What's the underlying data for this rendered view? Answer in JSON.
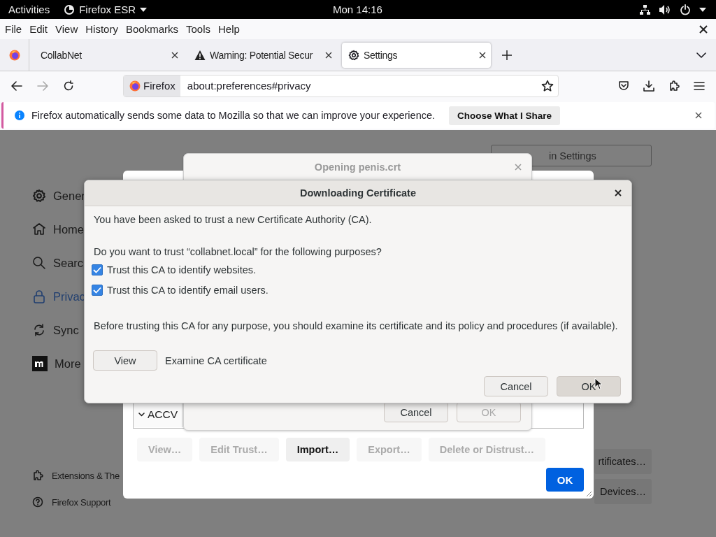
{
  "top_bar": {
    "activities": "Activities",
    "app_menu": "Firefox ESR",
    "clock": "Mon 14:16"
  },
  "menu_bar": {
    "items": [
      "File",
      "Edit",
      "View",
      "History",
      "Bookmarks",
      "Tools",
      "Help"
    ]
  },
  "tabs": [
    {
      "label": "CollabNet",
      "selected": false
    },
    {
      "label": "Warning: Potential Secur",
      "selected": false
    },
    {
      "label": "Settings",
      "selected": true
    }
  ],
  "address_bar": {
    "identity": "Firefox",
    "url": "about:preferences#privacy"
  },
  "notification": {
    "message": "Firefox automatically sends some data to Mozilla so that we can improve your experience.",
    "button": "Choose What I Share"
  },
  "settings": {
    "search": {
      "value": "in Settings"
    },
    "nav": [
      {
        "label": "Gener",
        "selected": false
      },
      {
        "label": "Home",
        "selected": false
      },
      {
        "label": "Searc",
        "selected": false
      },
      {
        "label": "Privac",
        "selected": true
      },
      {
        "label": "Sync",
        "selected": false
      },
      {
        "label": "More",
        "selected": false
      }
    ],
    "footer": [
      "Extensions & The",
      "Firefox Support"
    ],
    "buttons": [
      "rtificates…",
      "Devices…"
    ]
  },
  "certificate_manager": {
    "tree_rows": [
      {
        "label": "ACCV",
        "expanded": true
      }
    ],
    "buttons": [
      {
        "label": "View…",
        "disabled": true
      },
      {
        "label": "Edit Trust…",
        "disabled": true
      },
      {
        "label": "Import…",
        "disabled": false
      },
      {
        "label": "Export…",
        "disabled": true
      },
      {
        "label": "Delete or Distrust…",
        "disabled": true
      }
    ],
    "ok": "OK"
  },
  "opening_dialog": {
    "title": "Opening penis.crt",
    "buttons": [
      {
        "label": "Cancel",
        "disabled": false
      },
      {
        "label": "OK",
        "disabled": true
      }
    ]
  },
  "download_dialog": {
    "title": "Downloading Certificate",
    "intro": "You have been asked to trust a new Certificate Authority (CA).",
    "question": "Do you want to trust “collabnet.local” for the following purposes?",
    "options": [
      {
        "label": "Trust this CA to identify websites.",
        "checked": true
      },
      {
        "label": "Trust this CA to identify email users.",
        "checked": true
      }
    ],
    "advice": "Before trusting this CA for any purpose, you should examine its certificate and its policy and procedures (if available).",
    "view_button": "View",
    "view_note": "Examine CA certificate",
    "buttons": [
      {
        "label": "Cancel",
        "hovered": false
      },
      {
        "label": "OK",
        "hovered": true
      }
    ]
  }
}
